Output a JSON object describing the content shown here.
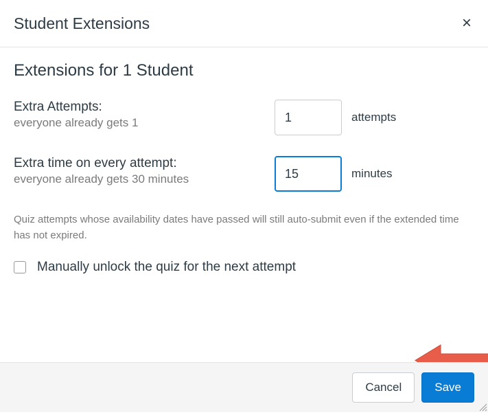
{
  "header": {
    "title": "Student Extensions"
  },
  "subtitle": "Extensions for 1 Student",
  "extraAttempts": {
    "label": "Extra Attempts:",
    "sublabel": "everyone already gets 1",
    "value": "1",
    "unit": "attempts"
  },
  "extraTime": {
    "label": "Extra time on every attempt:",
    "sublabel": "everyone already gets 30 minutes",
    "value": "15",
    "unit": "minutes"
  },
  "hint": "Quiz attempts whose availability dates have passed will still auto-submit even if the extended time has not expired.",
  "checkbox": {
    "label": "Manually unlock the quiz for the next attempt"
  },
  "footer": {
    "cancel": "Cancel",
    "save": "Save"
  }
}
